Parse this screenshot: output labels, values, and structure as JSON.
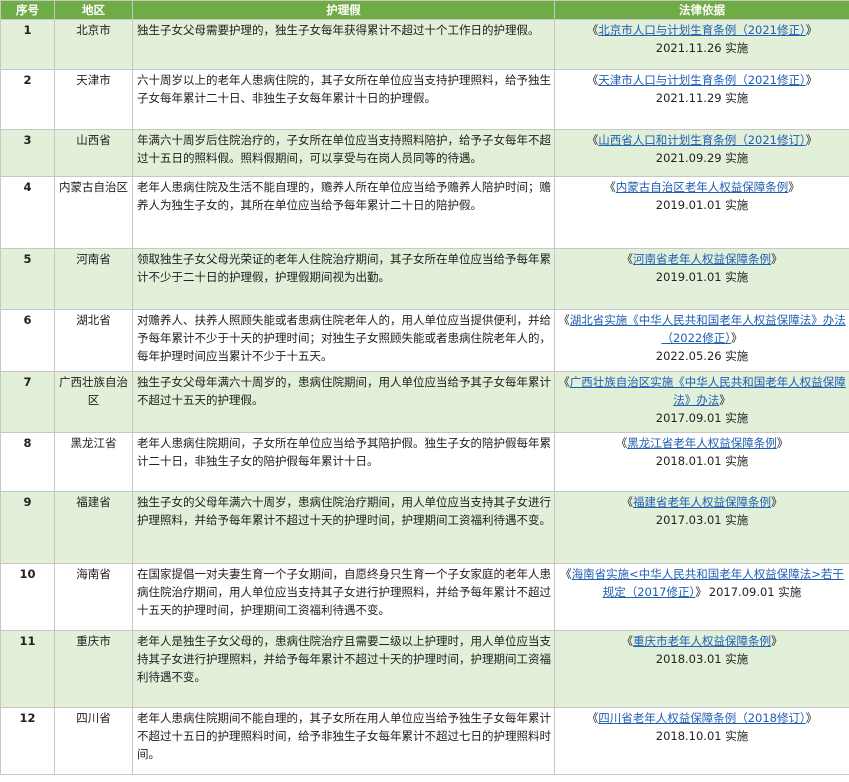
{
  "headers": {
    "no": "序号",
    "region": "地区",
    "leave": "护理假",
    "law": "法律依据"
  },
  "rows": [
    {
      "no": "1",
      "region": "北京市",
      "leave": "独生子女父母需要护理的，独生子女每年获得累计不超过十个工作日的护理假。",
      "law_open": "《",
      "law_title": "北京市人口与计划生育条例（2021修正）",
      "law_close": "》",
      "law_date": "2021.11.26 实施"
    },
    {
      "no": "2",
      "region": "天津市",
      "leave": "六十周岁以上的老年人患病住院的，其子女所在单位应当支持护理照料，给予独生子女每年累计二十日、非独生子女每年累计十日的护理假。",
      "law_open": "《",
      "law_title": "天津市人口与计划生育条例（2021修正）",
      "law_close": "》",
      "law_date": "2021.11.29 实施"
    },
    {
      "no": "3",
      "region": "山西省",
      "leave": "年满六十周岁后住院治疗的，子女所在单位应当支持照料陪护，给予子女每年不超过十五日的照料假。照料假期间，可以享受与在岗人员同等的待遇。",
      "law_open": "《",
      "law_title": "山西省人口和计划生育条例（2021修订）",
      "law_close": "》",
      "law_date": "2021.09.29 实施"
    },
    {
      "no": "4",
      "region": "内蒙古自治区",
      "leave": "老年人患病住院及生活不能自理的，赡养人所在单位应当给予赡养人陪护时间；赡养人为独生子女的，其所在单位应当给予每年累计二十日的陪护假。",
      "law_open": "《",
      "law_title": "内蒙古自治区老年人权益保障条例",
      "law_close": "》",
      "law_date": "2019.01.01 实施"
    },
    {
      "no": "5",
      "region": "河南省",
      "leave": "领取独生子女父母光荣证的老年人住院治疗期间，其子女所在单位应当给予每年累计不少于二十日的护理假，护理假期间视为出勤。",
      "law_open": "《",
      "law_title": "河南省老年人权益保障条例",
      "law_close": "》",
      "law_date": "2019.01.01 实施"
    },
    {
      "no": "6",
      "region": "湖北省",
      "leave": "对赡养人、扶养人照顾失能或者患病住院老年人的，用人单位应当提供便利，并给予每年累计不少于十天的护理时间；对独生子女照顾失能或者患病住院老年人的，每年护理时间应当累计不少于十五天。",
      "law_open": "《",
      "law_title": "湖北省实施《中华人民共和国老年人权益保障法》办法（2022修正）",
      "law_close": "》",
      "law_date": "2022.05.26 实施"
    },
    {
      "no": "7",
      "region": "广西壮族自治区",
      "leave": "独生子女父母年满六十周岁的，患病住院期间，用人单位应当给予其子女每年累计不超过十五天的护理假。",
      "law_open": "《",
      "law_title": "广西壮族自治区实施《中华人民共和国老年人权益保障法》办法",
      "law_close": "》",
      "law_date": "2017.09.01 实施"
    },
    {
      "no": "8",
      "region": "黑龙江省",
      "leave": "老年人患病住院期间，子女所在单位应当给予其陪护假。独生子女的陪护假每年累计二十日，非独生子女的陪护假每年累计十日。",
      "law_open": "《",
      "law_title": "黑龙江省老年人权益保障条例",
      "law_close": "》",
      "law_date": "2018.01.01 实施"
    },
    {
      "no": "9",
      "region": "福建省",
      "leave": "独生子女的父母年满六十周岁，患病住院治疗期间，用人单位应当支持其子女进行护理照料，并给予每年累计不超过十天的护理时间，护理期间工资福利待遇不变。",
      "law_open": "《",
      "law_title": "福建省老年人权益保障条例",
      "law_close": "》",
      "law_date": "2017.03.01 实施"
    },
    {
      "no": "10",
      "region": "海南省",
      "leave": "在国家提倡一对夫妻生育一个子女期间，自愿终身只生育一个子女家庭的老年人患病住院治疗期间，用人单位应当支持其子女进行护理照料，并给予每年累计不超过十五天的护理时间，护理期间工资福利待遇不变。",
      "law_open": "《",
      "law_title": "海南省实施<中华人民共和国老年人权益保障法>若干规定（2017修正）",
      "law_close": "》",
      "law_date": "2017.09.01 实施"
    },
    {
      "no": "11",
      "region": "重庆市",
      "leave": "老年人是独生子女父母的，患病住院治疗且需要二级以上护理时，用人单位应当支持其子女进行护理照料，并给予每年累计不超过十天的护理时间，护理期间工资福利待遇不变。",
      "law_open": "《",
      "law_title": "重庆市老年人权益保障条例",
      "law_close": "》",
      "law_date": "2018.03.01 实施"
    },
    {
      "no": "12",
      "region": "四川省",
      "leave": "老年人患病住院期间不能自理的，其子女所在用人单位应当给予独生子女每年累计不超过十五日的护理照料时间，给予非独生子女每年累计不超过七日的护理照料时间。",
      "law_open": "《",
      "law_title": "四川省老年人权益保障条例（2018修订）",
      "law_close": "》",
      "law_date": "2018.10.01 实施"
    }
  ]
}
